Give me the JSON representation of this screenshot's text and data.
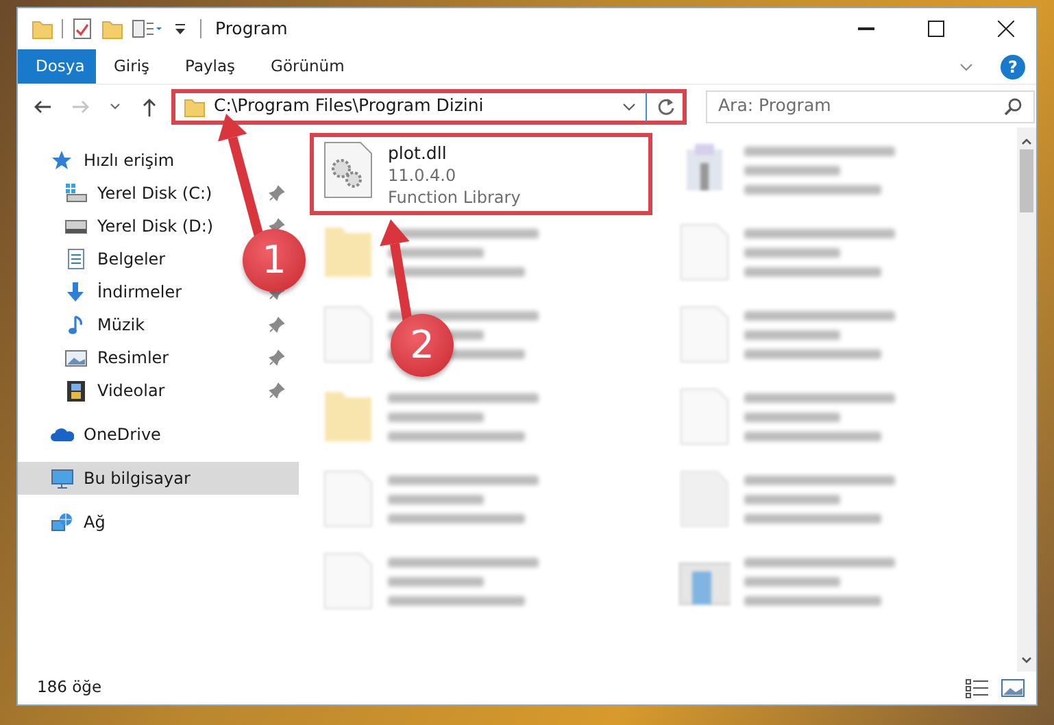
{
  "window": {
    "title": "Program"
  },
  "ribbon_tabs": [
    {
      "label": "Dosya",
      "selected": true
    },
    {
      "label": "Giriş",
      "selected": false
    },
    {
      "label": "Paylaş",
      "selected": false
    },
    {
      "label": "Görünüm",
      "selected": false
    }
  ],
  "help_button": {
    "label": "?"
  },
  "address": {
    "path": "C:\\Program Files\\Program Dizini",
    "highlighted": true
  },
  "search": {
    "placeholder": "Ara: Program"
  },
  "sidebar": {
    "items": [
      {
        "label": "Hızlı erişim",
        "kind": "star",
        "pinned": false,
        "selected": false,
        "children": [
          {
            "label": "Yerel Disk (C:)",
            "kind": "windrive",
            "pinned": true,
            "selected": false
          },
          {
            "label": "Yerel Disk (D:)",
            "kind": "drive",
            "pinned": true,
            "selected": false
          },
          {
            "label": "Belgeler",
            "kind": "docs",
            "pinned": false,
            "selected": false
          },
          {
            "label": "İndirmeler",
            "kind": "download",
            "pinned": true,
            "selected": false
          },
          {
            "label": "Müzik",
            "kind": "music",
            "pinned": true,
            "selected": false
          },
          {
            "label": "Resimler",
            "kind": "pictures",
            "pinned": true,
            "selected": false
          },
          {
            "label": "Videolar",
            "kind": "videos",
            "pinned": true,
            "selected": false
          }
        ]
      },
      {
        "label": "OneDrive",
        "kind": "cloud",
        "pinned": false,
        "selected": false
      },
      {
        "label": "Bu bilgisayar",
        "kind": "computer",
        "pinned": false,
        "selected": true
      },
      {
        "label": "Ağ",
        "kind": "network",
        "pinned": false,
        "selected": false
      }
    ]
  },
  "files": [
    {
      "kind": "dll",
      "blurred": false,
      "highlighted": true,
      "name": "plot.dll",
      "version": "11.0.4.0",
      "type": "Function Library"
    },
    {
      "kind": "exe",
      "blurred": true,
      "highlighted": false
    },
    {
      "kind": "folder",
      "blurred": true,
      "highlighted": false
    },
    {
      "kind": "file",
      "blurred": true,
      "highlighted": false
    },
    {
      "kind": "file",
      "blurred": true,
      "highlighted": false
    },
    {
      "kind": "file",
      "blurred": true,
      "highlighted": false
    },
    {
      "kind": "folder",
      "blurred": true,
      "highlighted": false
    },
    {
      "kind": "file",
      "blurred": true,
      "highlighted": false
    },
    {
      "kind": "file",
      "blurred": true,
      "highlighted": false
    },
    {
      "kind": "textfile",
      "blurred": true,
      "highlighted": false
    },
    {
      "kind": "file",
      "blurred": true,
      "highlighted": false
    },
    {
      "kind": "app",
      "blurred": true,
      "highlighted": false
    }
  ],
  "status_bar": {
    "count": "186 öğe"
  },
  "annotations": [
    {
      "label": "1"
    },
    {
      "label": "2"
    }
  ]
}
